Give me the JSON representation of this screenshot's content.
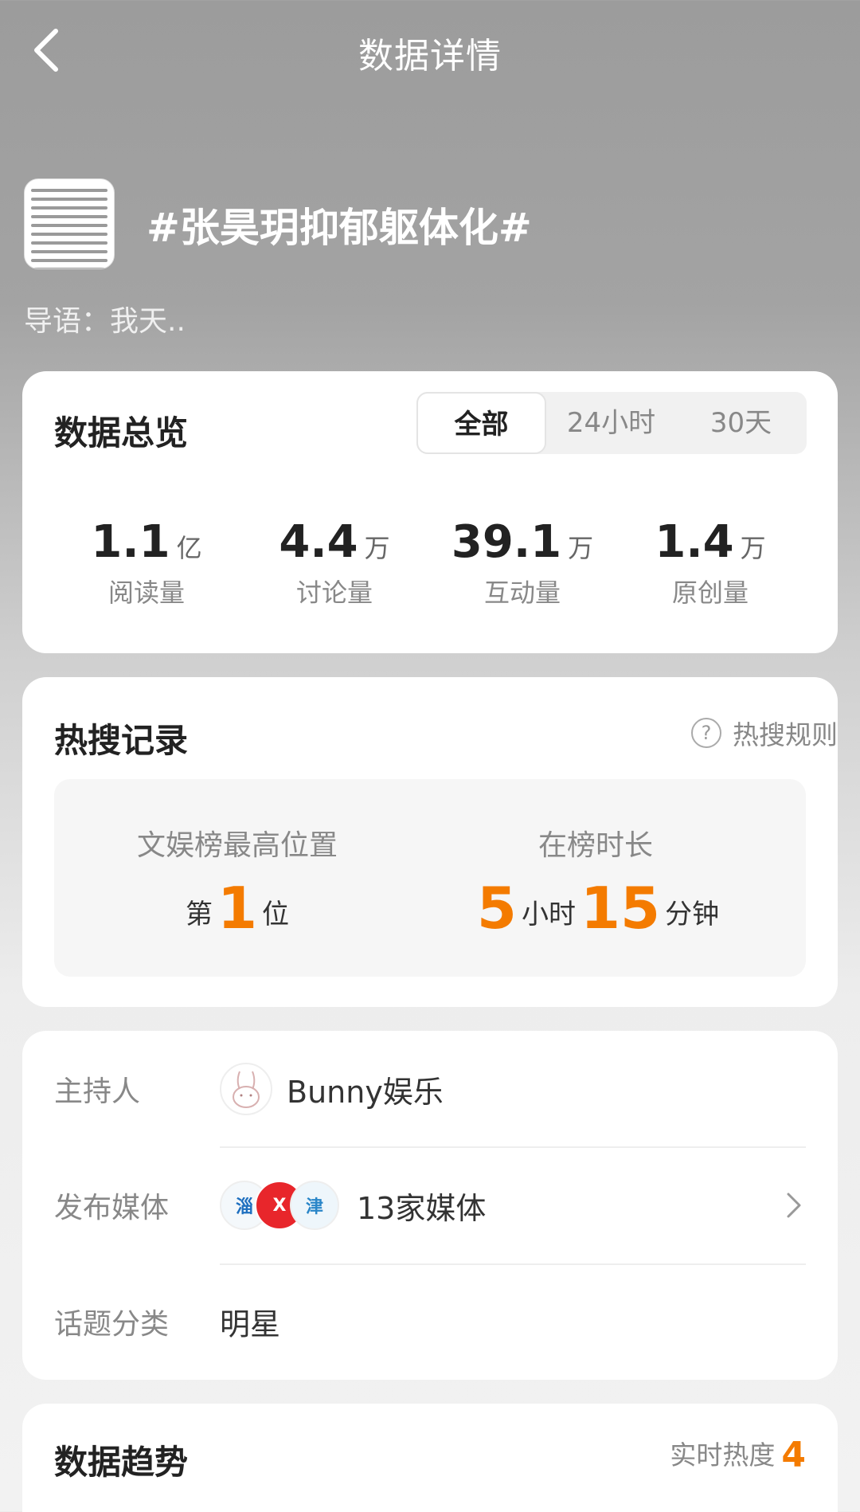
{
  "header": {
    "title": "数据详情"
  },
  "topic": {
    "title": "#张昊玥抑郁躯体化#",
    "intro": "导语：我天.."
  },
  "overview": {
    "title": "数据总览",
    "tabs": [
      "全部",
      "24小时",
      "30天"
    ],
    "active_tab": "全部",
    "stats": [
      {
        "value": "1.1",
        "unit": "亿",
        "label": "阅读量"
      },
      {
        "value": "4.4",
        "unit": "万",
        "label": "讨论量"
      },
      {
        "value": "39.1",
        "unit": "万",
        "label": "互动量"
      },
      {
        "value": "1.4",
        "unit": "万",
        "label": "原创量"
      }
    ]
  },
  "hot_search": {
    "title": "热搜记录",
    "rules": "热搜规则",
    "rank": {
      "label": "文娱榜最高位置",
      "prefix": "第",
      "value": "1",
      "suffix": "位"
    },
    "duration": {
      "label": "在榜时长",
      "hours": "5",
      "hours_unit": "小时",
      "minutes": "15",
      "minutes_unit": "分钟"
    }
  },
  "info": {
    "host_label": "主持人",
    "host_name": "Bunny娱乐",
    "media_label": "发布媒体",
    "media_value": "13家媒体",
    "category_label": "话题分类",
    "category_value": "明星"
  },
  "trend": {
    "title": "数据趋势",
    "realtime_label": "实时热度",
    "realtime_value": "4"
  },
  "colors": {
    "accent": "#f47b00"
  }
}
